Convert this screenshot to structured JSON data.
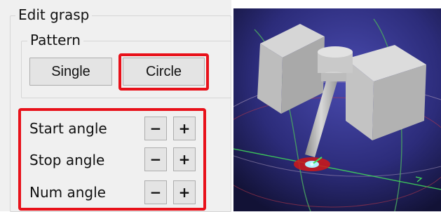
{
  "edit_grasp": {
    "title": "Edit grasp",
    "pattern": {
      "title": "Pattern",
      "single_label": "Single",
      "circle_label": "Circle"
    },
    "angles": [
      {
        "label": "Start angle",
        "minus": "−",
        "plus": "+"
      },
      {
        "label": "Stop angle",
        "minus": "−",
        "plus": "+"
      },
      {
        "label": "Num angle",
        "minus": "−",
        "plus": "+"
      }
    ]
  },
  "colors": {
    "highlight": "#e8111a",
    "panel_bg": "#f0f0f0",
    "viewport_bg": "#1c1c52"
  }
}
